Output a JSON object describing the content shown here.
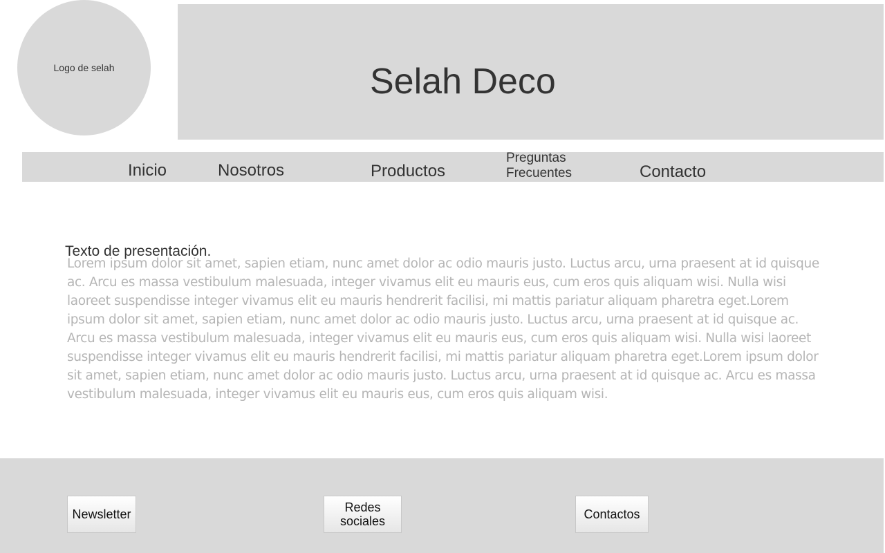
{
  "header": {
    "logo_text": "Logo de selah",
    "title": "Selah Deco"
  },
  "nav": {
    "items": [
      {
        "label": "Inicio"
      },
      {
        "label": "Nosotros"
      },
      {
        "label": "Productos"
      },
      {
        "label": "Preguntas Frecuentes"
      },
      {
        "label": "Contacto"
      }
    ]
  },
  "main": {
    "intro_title": "Texto de presentación.",
    "body_text": "Lorem ipsum dolor sit amet, sapien etiam, nunc amet dolor ac odio mauris justo. Luctus arcu, urna praesent at id quisque ac. Arcu es massa vestibulum malesuada, integer vivamus elit eu mauris eus, cum eros quis aliquam wisi. Nulla wisi laoreet suspendisse integer vivamus elit eu mauris hendrerit facilisi, mi mattis pariatur aliquam pharetra eget.Lorem ipsum dolor sit amet, sapien etiam, nunc amet dolor ac odio mauris justo. Luctus arcu, urna praesent at id quisque ac. Arcu es massa vestibulum malesuada, integer vivamus elit eu mauris eus, cum eros quis aliquam wisi. Nulla wisi laoreet suspendisse integer vivamus elit eu mauris hendrerit facilisi, mi mattis pariatur aliquam pharetra eget.Lorem ipsum dolor sit amet, sapien etiam, nunc amet dolor ac odio mauris justo. Luctus arcu, urna praesent at id quisque ac. Arcu es massa vestibulum malesuada, integer vivamus elit eu mauris eus, cum eros quis aliquam wisi."
  },
  "footer": {
    "buttons": [
      {
        "label": "Newsletter"
      },
      {
        "label": "Redes sociales"
      },
      {
        "label": "Contactos"
      }
    ]
  },
  "colors": {
    "panel": "#d9d9d9",
    "text": "#333333",
    "muted_text": "#b5b5b5"
  }
}
